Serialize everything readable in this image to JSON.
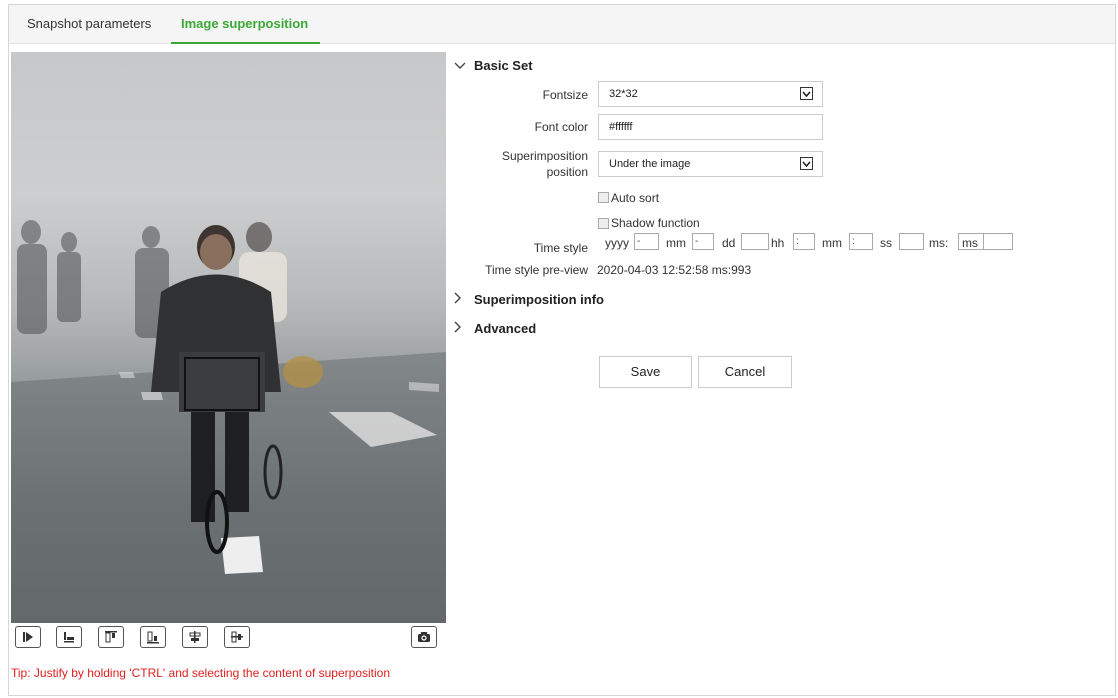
{
  "tabs": [
    {
      "label": "Snapshot parameters"
    },
    {
      "label": "Image superposition",
      "active": true
    }
  ],
  "accent_color": "#3aa935",
  "sections": {
    "basic": {
      "label": "Basic Set",
      "expanded": true
    },
    "superimposition_info": {
      "label": "Superimposition info",
      "expanded": false
    },
    "advanced": {
      "label": "Advanced",
      "expanded": false
    }
  },
  "form": {
    "fontsize": {
      "label": "Fontsize",
      "value": "32*32"
    },
    "font_color": {
      "label": "Font color",
      "value": "#ffffff"
    },
    "position": {
      "label_line1": "Superimposition",
      "label_line2": "position",
      "value": "Under the image"
    },
    "auto_sort": {
      "label": "Auto sort",
      "checked": false
    },
    "shadow": {
      "label": "Shadow function",
      "checked": false
    },
    "time_style": {
      "label": "Time style",
      "parts": [
        {
          "unit": "yyyy",
          "sep": "-"
        },
        {
          "unit": "mm",
          "sep": "-"
        },
        {
          "unit": "dd",
          "sep": ""
        },
        {
          "unit": "hh",
          "sep": ":"
        },
        {
          "unit": "mm",
          "sep": ":"
        },
        {
          "unit": "ss",
          "sep": ""
        },
        {
          "unit": "ms:",
          "sep": ""
        },
        {
          "unit": "ms",
          "sep": ""
        }
      ]
    },
    "preview": {
      "label": "Time style pre-view",
      "value": "2020-04-03 12:52:58 ms:993"
    }
  },
  "buttons": {
    "save": "Save",
    "cancel": "Cancel"
  },
  "video_toolbar": [
    "play-icon",
    "align-bottom-icon",
    "align-top-left-icon",
    "align-bottom-right-icon",
    "align-center-icon",
    "align-middle-icon",
    "camera-icon"
  ],
  "tip": "Tip: Justify by holding 'CTRL' and selecting the content of superposition",
  "tip_color": "#e02020"
}
